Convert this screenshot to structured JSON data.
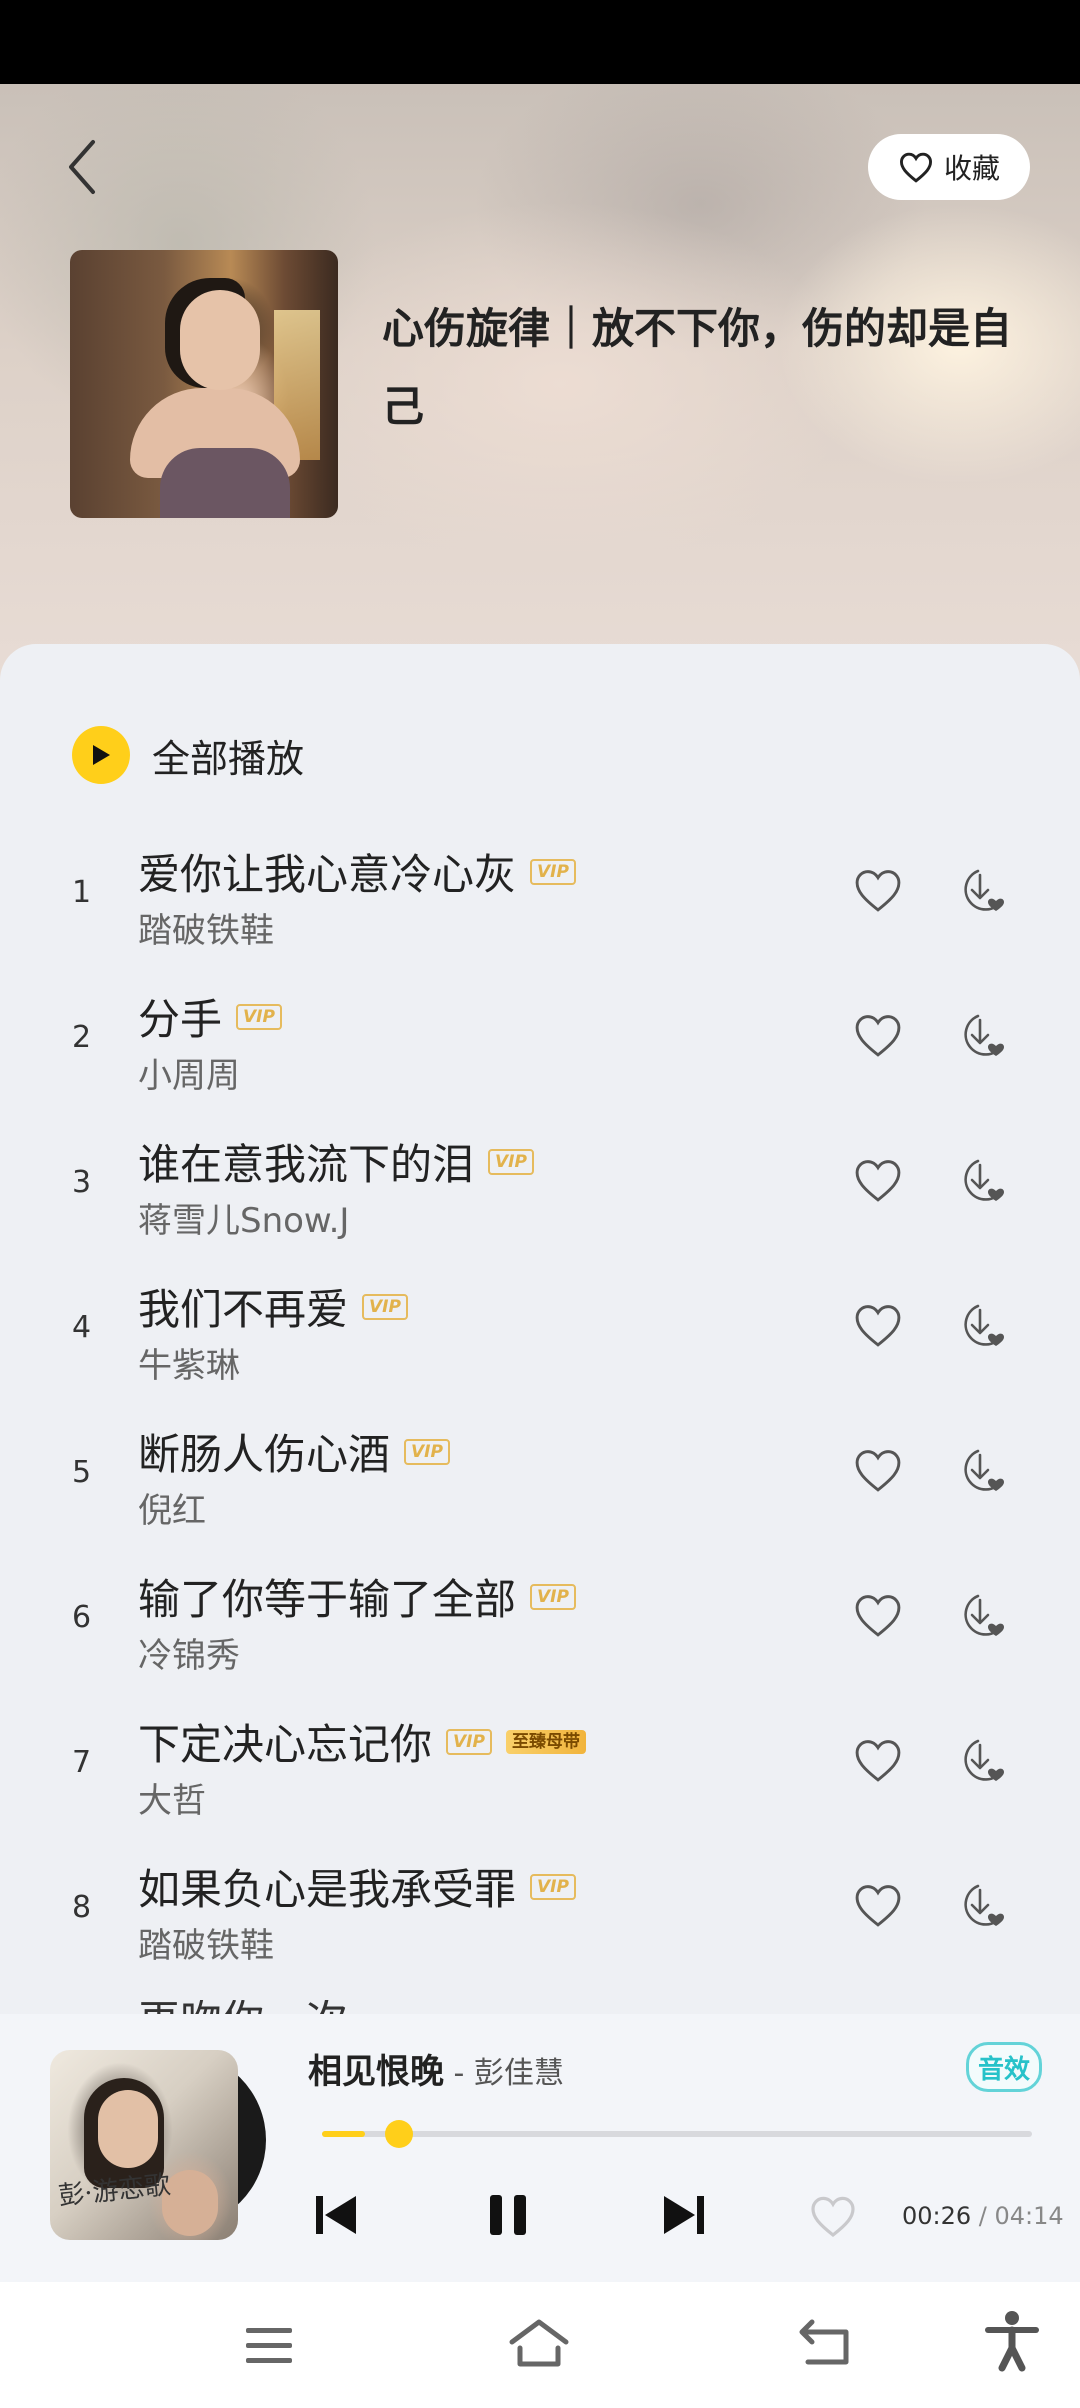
{
  "header": {
    "favorite_label": "收藏",
    "playlist_title": "心伤旋律｜放不下你，伤的却是自己"
  },
  "play_all_label": "全部播放",
  "songs": [
    {
      "index": "1",
      "title": "爱你让我心意冷心灰",
      "badges": [
        "VIP"
      ],
      "artist": "踏破铁鞋"
    },
    {
      "index": "2",
      "title": "分手",
      "badges": [
        "VIP"
      ],
      "artist": "小周周"
    },
    {
      "index": "3",
      "title": "谁在意我流下的泪",
      "badges": [
        "VIP"
      ],
      "artist": "蒋雪儿Snow.J"
    },
    {
      "index": "4",
      "title": "我们不再爱",
      "badges": [
        "VIP"
      ],
      "artist": "牛紫琳"
    },
    {
      "index": "5",
      "title": "断肠人伤心酒",
      "badges": [
        "VIP"
      ],
      "artist": "倪红"
    },
    {
      "index": "6",
      "title": "输了你等于输了全部",
      "badges": [
        "VIP"
      ],
      "artist": "冷锦秀"
    },
    {
      "index": "7",
      "title": "下定决心忘记你",
      "badges": [
        "VIP",
        "至臻母带"
      ],
      "artist": "大哲"
    },
    {
      "index": "8",
      "title": "如果负心是我承受罪",
      "badges": [
        "VIP"
      ],
      "artist": "踏破铁鞋"
    }
  ],
  "peek_row_title": "再吻你一次",
  "now_playing": {
    "title": "相见恨晚",
    "artist_sep": " - ",
    "artist": "彭佳慧",
    "effect_label": "音效",
    "elapsed": "00:26",
    "time_sep": " / ",
    "total": "04:14",
    "progress_fraction": 0.06,
    "cover_text": "彭·游恋歌"
  },
  "colors": {
    "accent": "#ffcf1a",
    "vip_badge": "#e6bb5d",
    "effect": "#27c2c9"
  },
  "icons": {
    "back": "chevron-left-icon",
    "favorite": "heart-icon",
    "play_all": "play-icon",
    "like": "heart-icon",
    "download": "download-icon",
    "prev": "skip-previous-icon",
    "pause": "pause-icon",
    "next": "skip-next-icon",
    "nav_menu": "menu-icon",
    "nav_home": "home-icon",
    "nav_back": "back-icon",
    "nav_accessibility": "accessibility-icon"
  }
}
